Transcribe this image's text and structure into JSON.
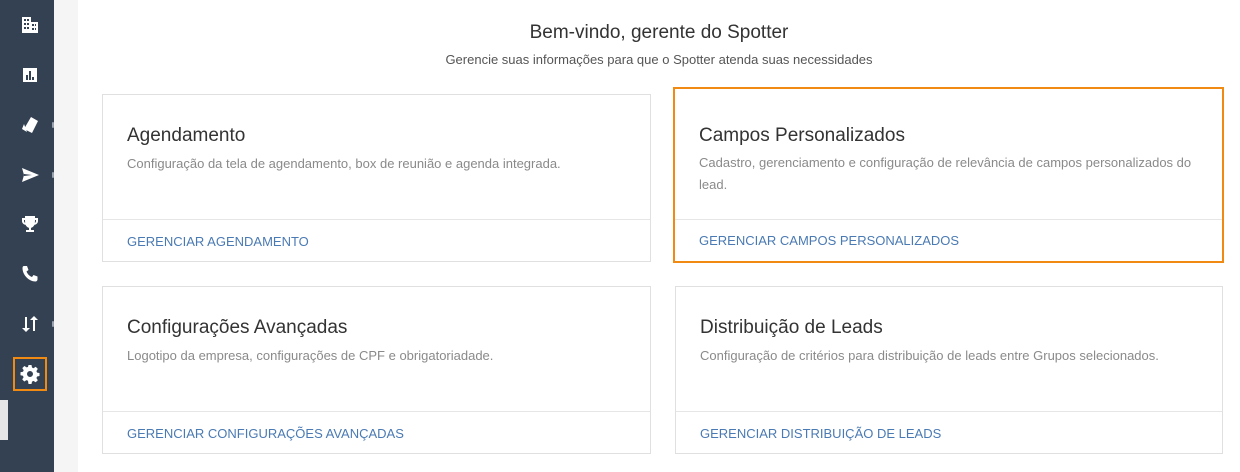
{
  "sidebar": {
    "items": [
      {
        "icon": "building-icon",
        "label": ""
      },
      {
        "icon": "report-icon",
        "label": ""
      },
      {
        "icon": "tag-icon",
        "label": ""
      },
      {
        "icon": "send-icon",
        "label": ""
      },
      {
        "icon": "trophy-icon",
        "label": ""
      },
      {
        "icon": "phone-icon",
        "label": ""
      },
      {
        "icon": "transfer-icon",
        "label": ""
      },
      {
        "icon": "gear-icon",
        "label": "",
        "active": true
      }
    ],
    "accent_color": "#f08a12",
    "background_color": "#344152"
  },
  "header": {
    "title": "Bem-vindo, gerente do Spotter",
    "subtitle": "Gerencie suas informações para que o Spotter atenda suas necessidades"
  },
  "cards": [
    {
      "title": "Agendamento",
      "description": "Configuração da tela de agendamento, box de reunião e agenda integrada.",
      "link": "GERENCIAR AGENDAMENTO"
    },
    {
      "title": "Campos Personalizados",
      "description": "Cadastro, gerenciamento e configuração de relevância de campos personalizados do lead.",
      "link": "GERENCIAR CAMPOS PERSONALIZADOS",
      "highlighted": true
    },
    {
      "title": "Configurações Avançadas",
      "description": "Logotipo da empresa, configurações de CPF e obrigatoriadade.",
      "link": "GERENCIAR CONFIGURAÇÕES AVANÇADAS"
    },
    {
      "title": "Distribuição de Leads",
      "description": "Configuração de critérios para distribuição de leads entre Grupos selecionados.",
      "link": "GERENCIAR DISTRIBUIÇÃO DE LEADS"
    }
  ],
  "colors": {
    "link": "#4a7ab3",
    "highlight": "#f08a12"
  }
}
